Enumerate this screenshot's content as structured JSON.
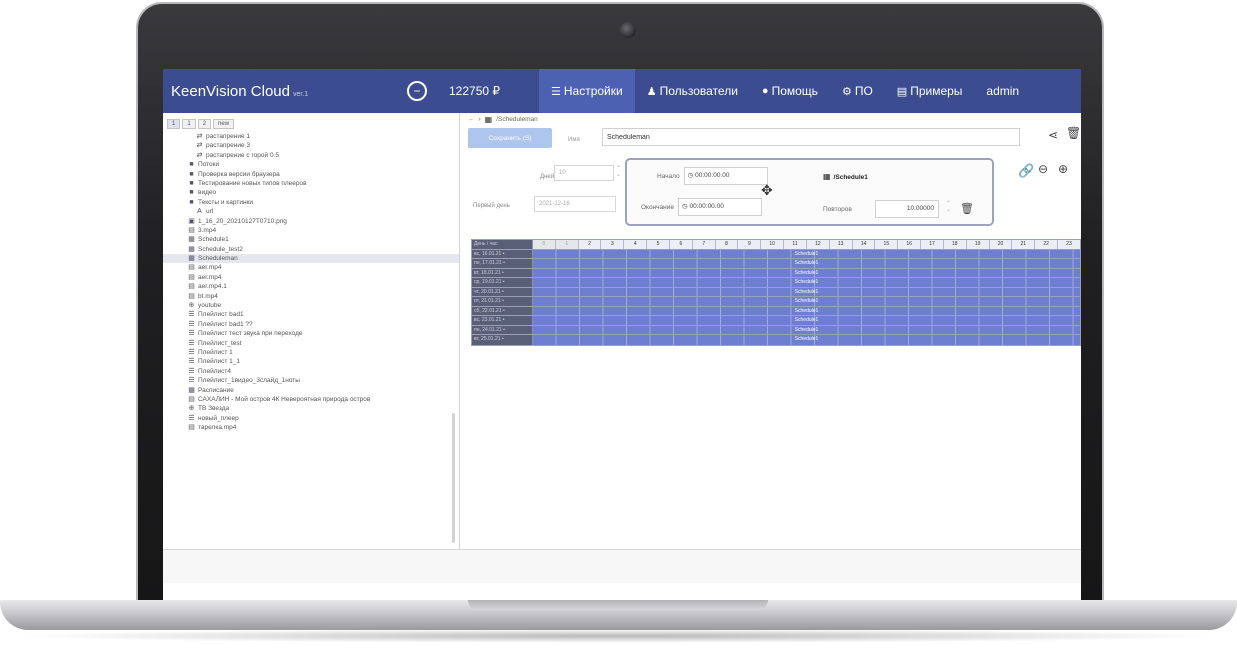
{
  "header": {
    "logo": "KeenVision Cloud",
    "logo_version": "ver.1",
    "toggle_symbol": "−",
    "balance": "122750 ₽",
    "menu": [
      {
        "icon": "☰",
        "label": "Настройки",
        "active": true
      },
      {
        "icon": "♟",
        "label": "Пользователи"
      },
      {
        "icon": "●",
        "label": "Помощь"
      },
      {
        "icon": "⚙",
        "label": "ПО"
      },
      {
        "icon": "▤",
        "label": "Примеры"
      },
      {
        "icon": "",
        "label": "admin"
      }
    ]
  },
  "sidebar": {
    "tabs": [
      "1",
      "1",
      "2",
      "new"
    ],
    "items": [
      {
        "icon": "⇄",
        "label": "растапрение 1",
        "indent": 2
      },
      {
        "icon": "⇄",
        "label": "растапрение 3",
        "indent": 2
      },
      {
        "icon": "⇄",
        "label": "растапрение с горой 0.5",
        "indent": 2
      },
      {
        "icon": "■",
        "label": "Потоки",
        "indent": 1
      },
      {
        "icon": "■",
        "label": "Проверка версии браузера",
        "indent": 1
      },
      {
        "icon": "■",
        "label": "Тестирование новых типов плееров",
        "indent": 1
      },
      {
        "icon": "■",
        "label": "видео",
        "indent": 1
      },
      {
        "icon": "■",
        "label": "Тексты и картинки",
        "indent": 1
      },
      {
        "icon": "A",
        "label": "url",
        "indent": 2
      },
      {
        "icon": "▣",
        "label": "1_16_20_20210127T0710.png",
        "indent": 1
      },
      {
        "icon": "▤",
        "label": "3.mp4",
        "indent": 1
      },
      {
        "icon": "▦",
        "label": "Schedule1",
        "indent": 1
      },
      {
        "icon": "▦",
        "label": "Schedule_test2",
        "indent": 1
      },
      {
        "icon": "▦",
        "label": "Scheduleman",
        "indent": 1,
        "selected": true
      },
      {
        "icon": "▤",
        "label": "aer.mp4",
        "indent": 1
      },
      {
        "icon": "▤",
        "label": "aer.mp4",
        "indent": 1
      },
      {
        "icon": "▤",
        "label": "aer.mp4.1",
        "indent": 1
      },
      {
        "icon": "▤",
        "label": "bt.mp4",
        "indent": 1
      },
      {
        "icon": "⊕",
        "label": "youtube",
        "indent": 1
      },
      {
        "icon": "☰",
        "label": "Плейлист bad1",
        "indent": 1
      },
      {
        "icon": "☰",
        "label": "Плейлист bad1 ??",
        "indent": 1
      },
      {
        "icon": "☰",
        "label": "Плейлист тест звука при переходе",
        "indent": 1
      },
      {
        "icon": "☰",
        "label": "Плейлист_test",
        "indent": 1
      },
      {
        "icon": "☰",
        "label": "Плейлист 1",
        "indent": 1
      },
      {
        "icon": "☰",
        "label": "Плейлист 1_1",
        "indent": 1
      },
      {
        "icon": "☰",
        "label": "Плейлист4",
        "indent": 1
      },
      {
        "icon": "☰",
        "label": "Плейлист_1видео_3слайд_1ноты",
        "indent": 1
      },
      {
        "icon": "▦",
        "label": "Расписание",
        "indent": 1
      },
      {
        "icon": "▤",
        "label": "САХАЛИН - Мой остров 4К Невероятная природа остров",
        "indent": 1
      },
      {
        "icon": "⊕",
        "label": "ТВ Звезда",
        "indent": 1
      },
      {
        "icon": "☰",
        "label": "новый_плеер",
        "indent": 1
      },
      {
        "icon": "▤",
        "label": "тарелка.mp4",
        "indent": 1
      }
    ]
  },
  "main": {
    "breadcrumb": {
      "back": "←",
      "sep": "›",
      "title": "/Scheduleman"
    },
    "save_label": "Сохранить (S)",
    "name_label": "Имя",
    "name_value": "Scheduleman",
    "days_label": "Дней",
    "days_value": "10",
    "first_day_label": "Первый день",
    "first_day_value": "2021-12-16",
    "slot": {
      "start_label": "Начало",
      "start_value": "◷ 00:00:00.00",
      "end_label": "Окончание",
      "end_value": "◷ 00:00:00.00",
      "schedule_ref": "/Schedule1",
      "repeat_label": "Повторов",
      "repeat_value": "10.00000"
    },
    "grid": {
      "corner_label": "День / час",
      "hours": [
        "0",
        "1",
        "2",
        "3",
        "4",
        "5",
        "6",
        "7",
        "8",
        "9",
        "10",
        "11",
        "12",
        "13",
        "14",
        "15",
        "16",
        "17",
        "18",
        "19",
        "20",
        "21",
        "22",
        "23"
      ],
      "days": [
        "вс, 16.01.21 •",
        "пн, 17.01.21 •",
        "вт, 18.01.21 •",
        "ср, 19.01.21 •",
        "чт, 20.01.21 •",
        "пт, 21.01.21 •",
        "сб, 22.01.21 •",
        "вс, 23.01.21 •",
        "пн, 24.01.21 •",
        "вт, 25.01.21 •"
      ],
      "slot_label": "Schedule1"
    }
  }
}
